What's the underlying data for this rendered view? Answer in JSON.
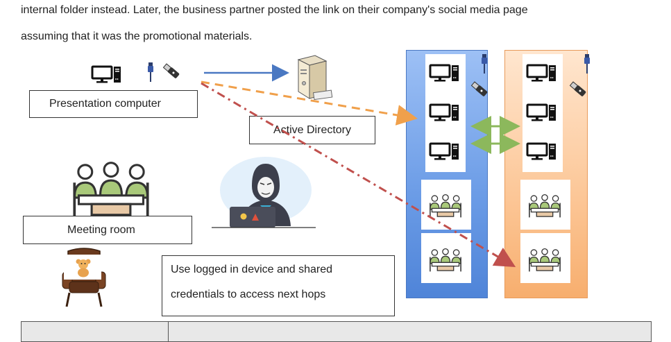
{
  "paragraph": {
    "line1": "internal folder instead. Later, the business partner posted the link on their company's social media page",
    "line2": "assuming that it was the promotional materials."
  },
  "labels": {
    "presentation_computer": "Presentation computer",
    "active_directory": "Active Directory",
    "meeting_room": "Meeting room",
    "note_line1": "Use logged in device and shared",
    "note_line2": "credentials to access next hops"
  },
  "icons": {
    "computer": "computer-icon",
    "ethernet": "ethernet-cable-icon",
    "usb": "usb-drive-icon",
    "server": "server-icon",
    "meeting": "meeting-room-icon",
    "hacker": "hacker-icon",
    "chair": "armchair-icon",
    "teddy": "teddy-bear-icon"
  },
  "colors": {
    "blue_panel": "#5b8fe0",
    "orange_panel": "#f7b98a",
    "arrow_blue": "#4a78c2",
    "arrow_orange": "#f0a04b",
    "arrow_red": "#c0504d",
    "arrow_green": "#8cb85c"
  }
}
